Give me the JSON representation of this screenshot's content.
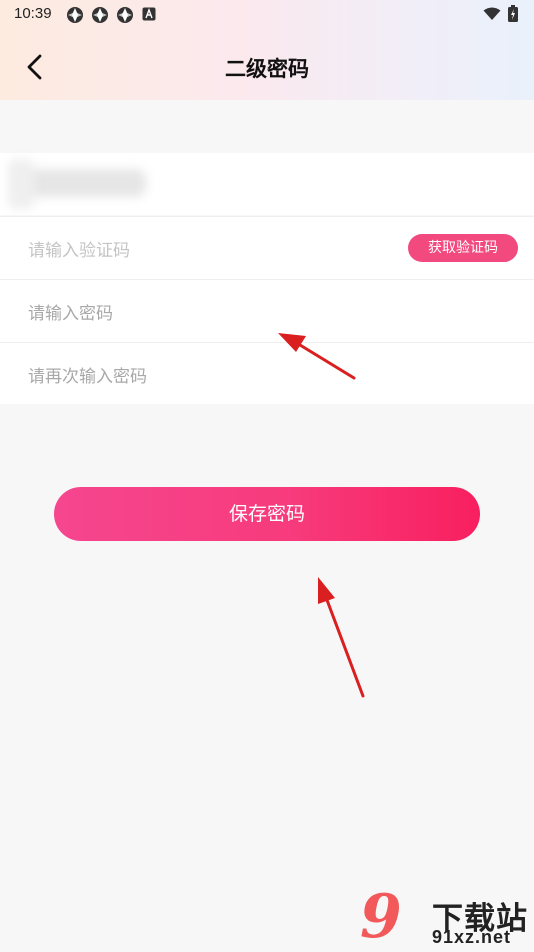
{
  "status_bar": {
    "time": "10:39"
  },
  "header": {
    "title": "二级密码"
  },
  "form": {
    "code_placeholder": "请输入验证码",
    "get_code_label": "获取验证码",
    "password_placeholder": "请输入密码",
    "confirm_placeholder": "请再次输入密码"
  },
  "save_label": "保存密码",
  "watermark": {
    "text": "下载站",
    "domain": "91xz.net"
  },
  "colors": {
    "accent": "#f24a7f",
    "button_start": "#f6468f",
    "button_end": "#f81f5f",
    "annotation_arrow": "#d91f1f",
    "page_bg": "#f7f7f7"
  }
}
